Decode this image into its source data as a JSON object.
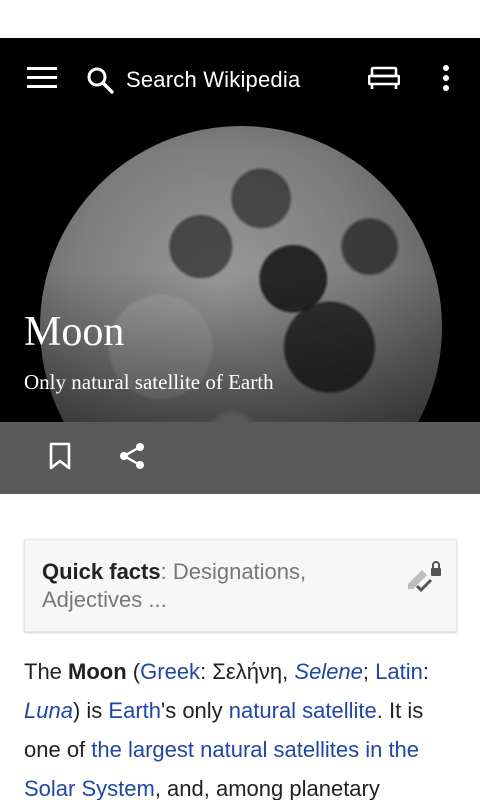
{
  "toolbar": {
    "search_placeholder": "Search Wikipedia",
    "menu_icon": "hamburger-menu-icon",
    "search_icon": "search-icon",
    "reading_icon": "reading-list-icon",
    "more_icon": "overflow-menu-icon"
  },
  "article": {
    "title": "Moon",
    "description": "Only natural satellite of Earth"
  },
  "actions": {
    "save_icon": "bookmark-icon",
    "share_icon": "share-icon"
  },
  "quick_facts": {
    "label": "Quick facts",
    "summary": ": Designations, Adjectives ..."
  },
  "intro": {
    "t1": "The ",
    "moon": "Moon",
    "t2": " (",
    "link_greek": "Greek",
    "t3": ": Σελήνη, ",
    "link_selene": "Selene",
    "t4": "; ",
    "link_latin": "Latin",
    "t5": ": ",
    "link_luna": "Luna",
    "t6": ") is ",
    "link_earth": "Earth",
    "t7": "'s only ",
    "link_natural_satellite": "natural satellite",
    "t8": ". It is one of ",
    "link_largest": "the largest natural satellites in the ",
    "link_solar_system": "Solar System",
    "t9": ", and, among planetary"
  },
  "colors": {
    "link": "#1f47a3",
    "action_bar": "#5a5a5a",
    "accent": "#2a9fd6"
  }
}
